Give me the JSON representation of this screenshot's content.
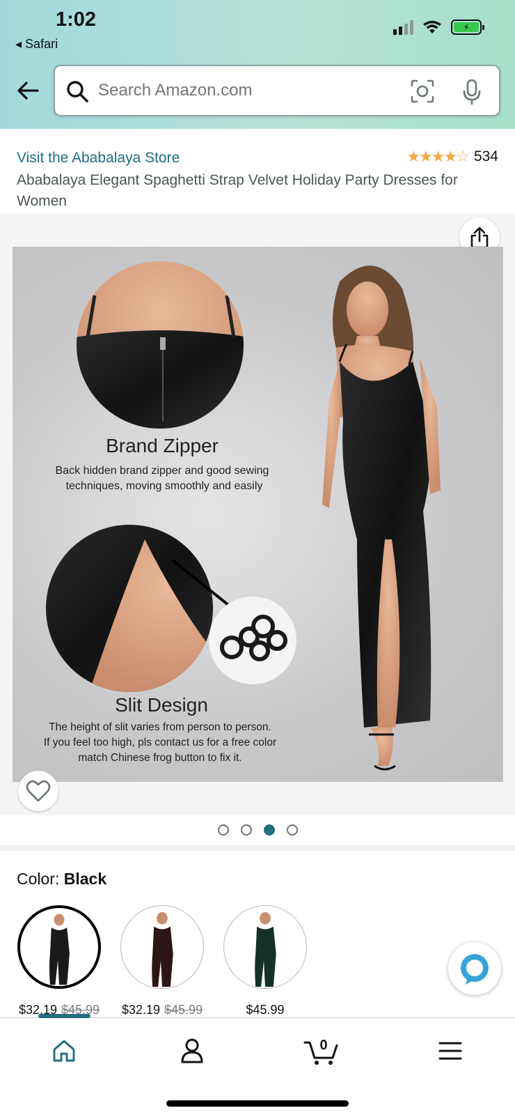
{
  "status_bar": {
    "time": "1:02",
    "back_app": "Safari"
  },
  "search": {
    "placeholder": "Search Amazon.com"
  },
  "product": {
    "store_link": "Visit the Ababalaya Store",
    "rating_count": "534",
    "stars": 4.5,
    "title": "Ababalaya Elegant Spaghetti Strap Velvet Holiday Party Dresses for Women"
  },
  "image": {
    "heading1": "Brand Zipper",
    "desc1_line1": "Back hidden brand zipper and good sewing",
    "desc1_line2": "techniques, moving smoothly and easily",
    "heading2": "Slit Design",
    "desc2_line1": "The height of slit varies from person to person.",
    "desc2_line2": "If you feel too high, pls contact us for a free color",
    "desc2_line3": "match Chinese frog button to fix it."
  },
  "carousel": {
    "count": 4,
    "active": 3
  },
  "color": {
    "label": "Color:",
    "selected": "Black",
    "swatches": [
      {
        "price": "$32.19",
        "old_price": "$45.99",
        "tone": "#1a1a1a"
      },
      {
        "price": "$32.19",
        "old_price": "$45.99",
        "tone": "#2d1416"
      },
      {
        "price": "$45.99",
        "old_price": "",
        "tone": "#16302a"
      }
    ]
  },
  "tabs": {
    "cart_count": "0"
  },
  "colors": {
    "accent": "#246f80",
    "star": "#f3a847",
    "link": "#1f6e82"
  }
}
